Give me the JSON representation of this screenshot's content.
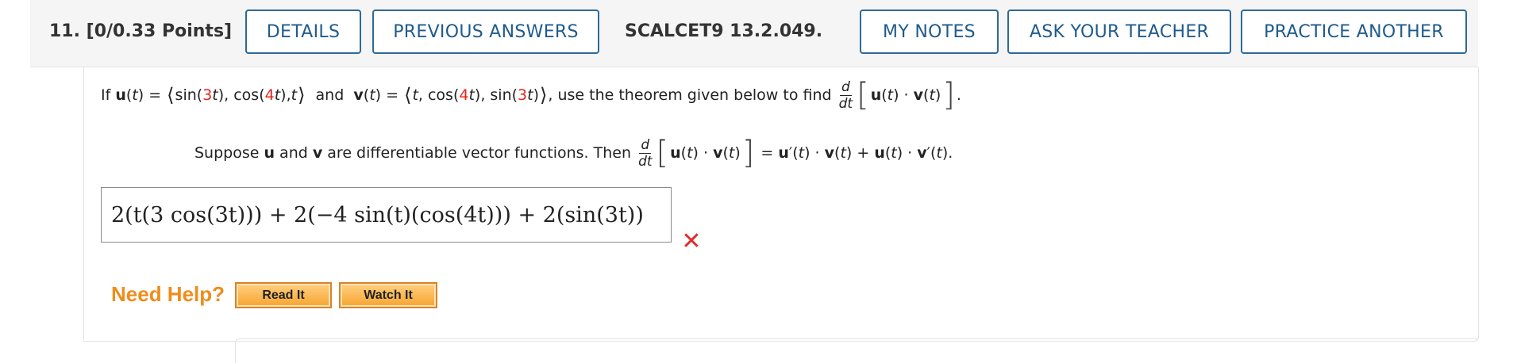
{
  "question": {
    "number": "11.",
    "points": "[0/0.33 Points]",
    "assignment_id": "SCALCET9 13.2.049."
  },
  "buttons": {
    "details": "DETAILS",
    "previous_answers": "PREVIOUS ANSWERS",
    "my_notes": "MY NOTES",
    "ask_teacher": "ASK YOUR TEACHER",
    "practice_another": "PRACTICE ANOTHER"
  },
  "problem": {
    "if": "If",
    "and": "and",
    "use_text": ", use the theorem given below to find",
    "suppose_text": "Suppose",
    "are_diff": "are differentiable vector functions. Then"
  },
  "answer": {
    "value": "2(t(3 cos(3t))) + 2(−4 sin(t)(cos(4t))) + 2(sin(3t))",
    "status": "incorrect"
  },
  "help": {
    "label": "Need Help?",
    "read_it": "Read It",
    "watch_it": "Watch It"
  },
  "colors": {
    "button_border": "#2c6a9a",
    "highlight_red": "#e4261b",
    "need_help": "#f08c1a",
    "incorrect_icon": "#e02b2b"
  },
  "icons": {
    "status": "incorrect-x-icon"
  }
}
